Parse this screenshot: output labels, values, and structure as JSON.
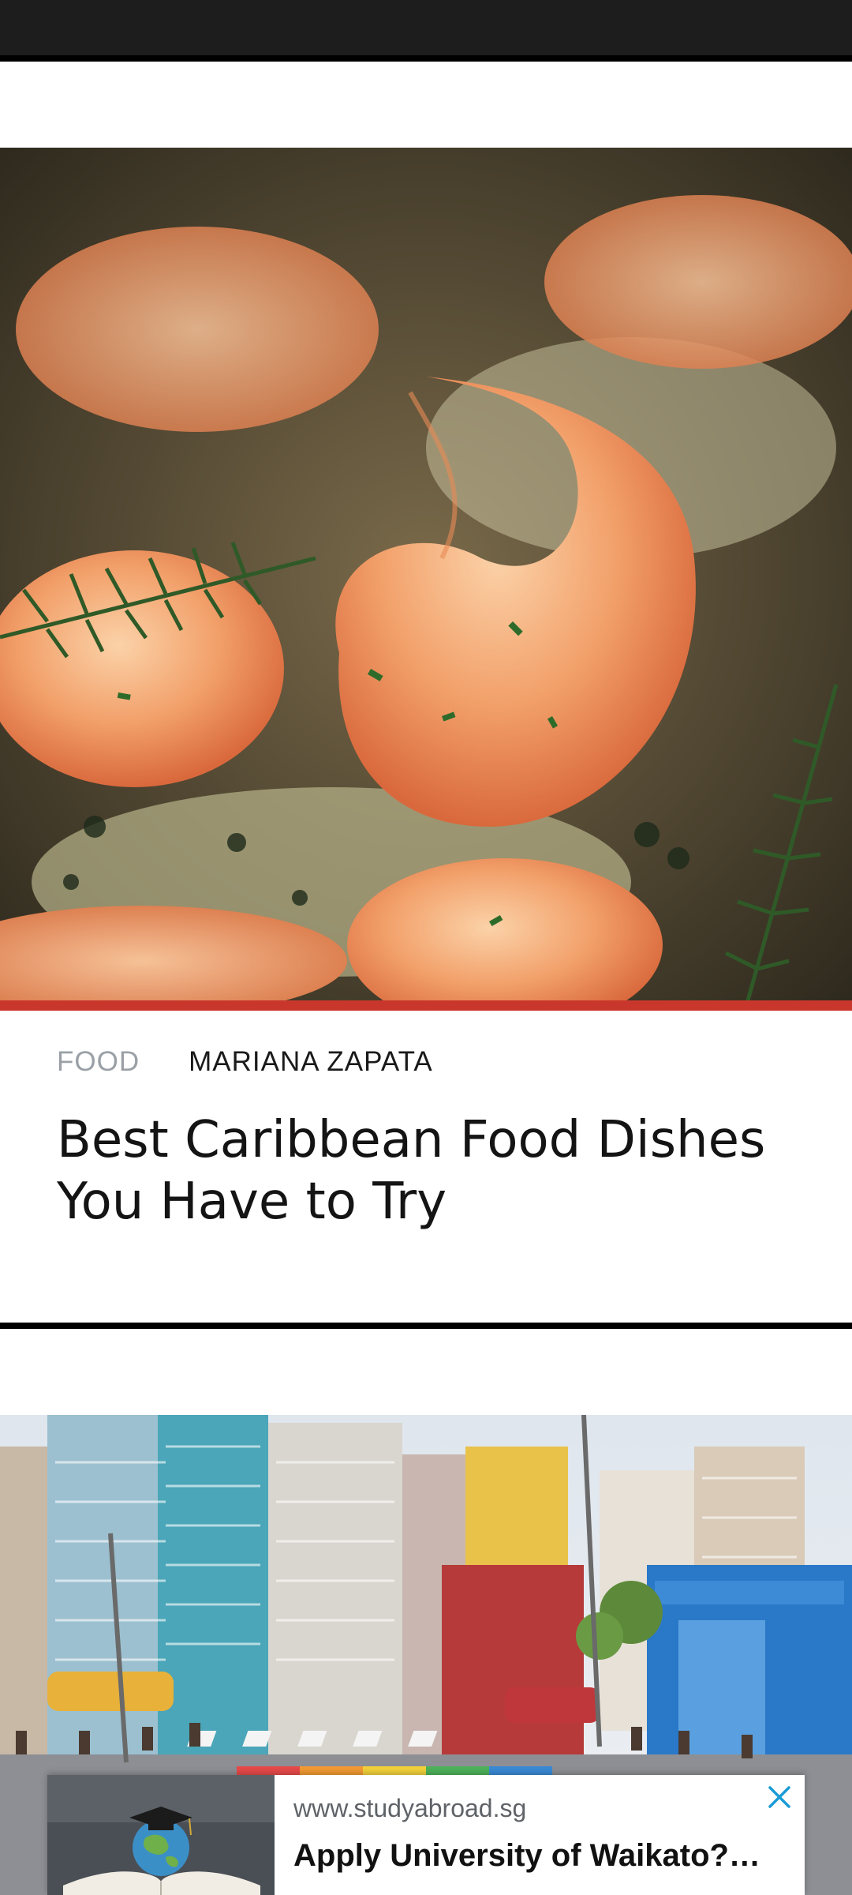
{
  "article": {
    "category": "FOOD",
    "author": "MARIANA ZAPATA",
    "title": "Best Caribbean Food Dishes You Have to Try"
  },
  "ad": {
    "domain": "www.studyabroad.sg",
    "title": "Apply University of Waikato?…"
  },
  "colors": {
    "accent": "#c9372c",
    "status_bar": "#1d1d1d",
    "ad_close": "#1a9bd7"
  },
  "icons": {
    "hero": "shrimp-photo",
    "second": "city-street-photo",
    "ad_thumb": "graduation-globe-photo",
    "ad_close": "close-icon"
  }
}
